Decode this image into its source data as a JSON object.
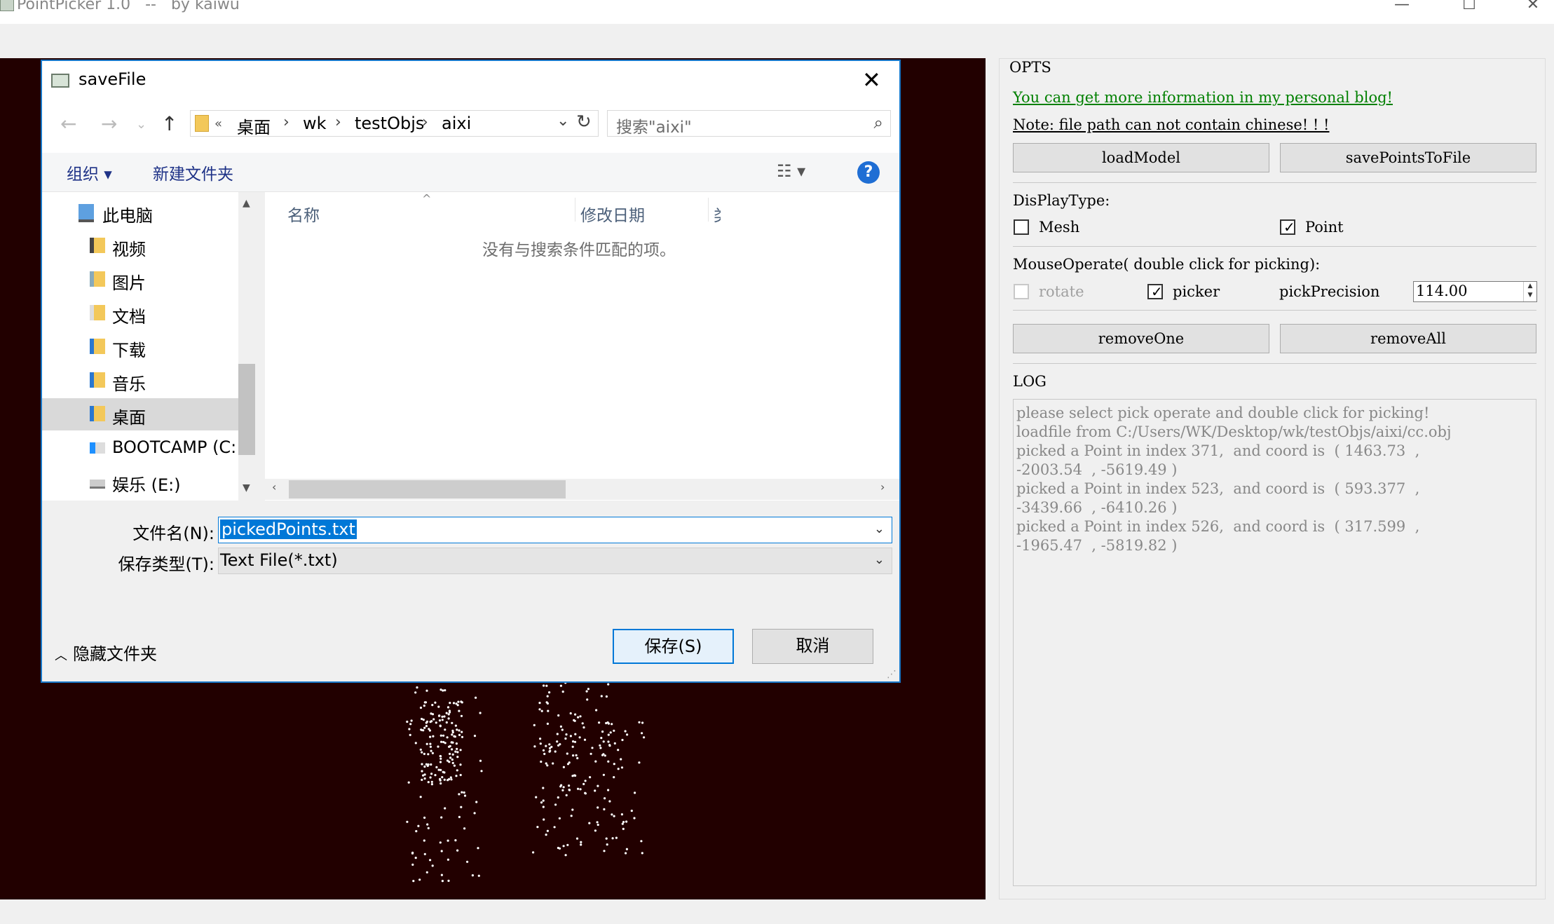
{
  "window": {
    "title": "PointPicker 1.0   --   by kaiwu",
    "controls": {
      "minimize": "—",
      "maximize": "☐",
      "close": "✕"
    }
  },
  "opts": {
    "group_title": "OPTS",
    "blog_link": "You can get more information in my personal blog!",
    "note": "Note: file path can not contain chinese! ! !",
    "load_model": "loadModel",
    "save_points": "savePointsToFile",
    "display_type_label": "DisPlayType:",
    "mesh_label": "Mesh",
    "mesh_checked": false,
    "point_label": "Point",
    "point_checked": true,
    "mouse_operate_label": "MouseOperate( double click for picking):",
    "rotate_label": "rotate",
    "rotate_checked": false,
    "picker_label": "picker",
    "picker_checked": true,
    "pick_precision_label": "pickPrecision",
    "pick_precision_value": "114.00",
    "remove_one": "removeOne",
    "remove_all": "removeAll",
    "log_label": "LOG",
    "log_lines": [
      "please select pick operate and double click for picking!",
      "loadfile from C:/Users/WK/Desktop/wk/testObjs/aixi/cc.obj",
      "picked a Point in index 371,  and coord is  ( 1463.73  ,",
      "-2003.54  , -5619.49 )",
      "picked a Point in index 523,  and coord is  ( 593.377  ,",
      "-3439.66  , -6410.26 )",
      "picked a Point in index 526,  and coord is  ( 317.599  ,",
      "-1965.47  , -5819.82 )"
    ],
    "colors": {
      "link": "#008000",
      "log_text": "#888888"
    }
  },
  "dialog": {
    "title": "saveFile",
    "close": "✕",
    "breadcrumbs": [
      "«",
      "桌面",
      "wk",
      "testObjs",
      "aixi"
    ],
    "search_placeholder": "搜索\"aixi\"",
    "organize": "组织 ▾",
    "new_folder": "新建文件夹",
    "help": "?",
    "nav_items": [
      {
        "label": "此电脑",
        "icon": "computer-icon"
      },
      {
        "label": "视频",
        "icon": "video-folder-icon"
      },
      {
        "label": "图片",
        "icon": "pictures-folder-icon"
      },
      {
        "label": "文档",
        "icon": "documents-folder-icon"
      },
      {
        "label": "下载",
        "icon": "downloads-folder-icon"
      },
      {
        "label": "音乐",
        "icon": "music-folder-icon"
      },
      {
        "label": "桌面",
        "icon": "desktop-folder-icon"
      },
      {
        "label": "BOOTCAMP (C:",
        "icon": "windows-drive-icon"
      },
      {
        "label": "娱乐 (E:)",
        "icon": "drive-icon"
      }
    ],
    "selected_nav": "桌面",
    "columns": [
      "名称",
      "修改日期",
      "类"
    ],
    "empty_message": "没有与搜索条件匹配的项。",
    "filename_label": "文件名(N):",
    "filename_value": "pickedPoints.txt",
    "filetype_label": "保存类型(T):",
    "filetype_value": "Text File(*.txt)",
    "hide_folders": "隐藏文件夹",
    "save": "保存(S)",
    "cancel": "取消"
  }
}
